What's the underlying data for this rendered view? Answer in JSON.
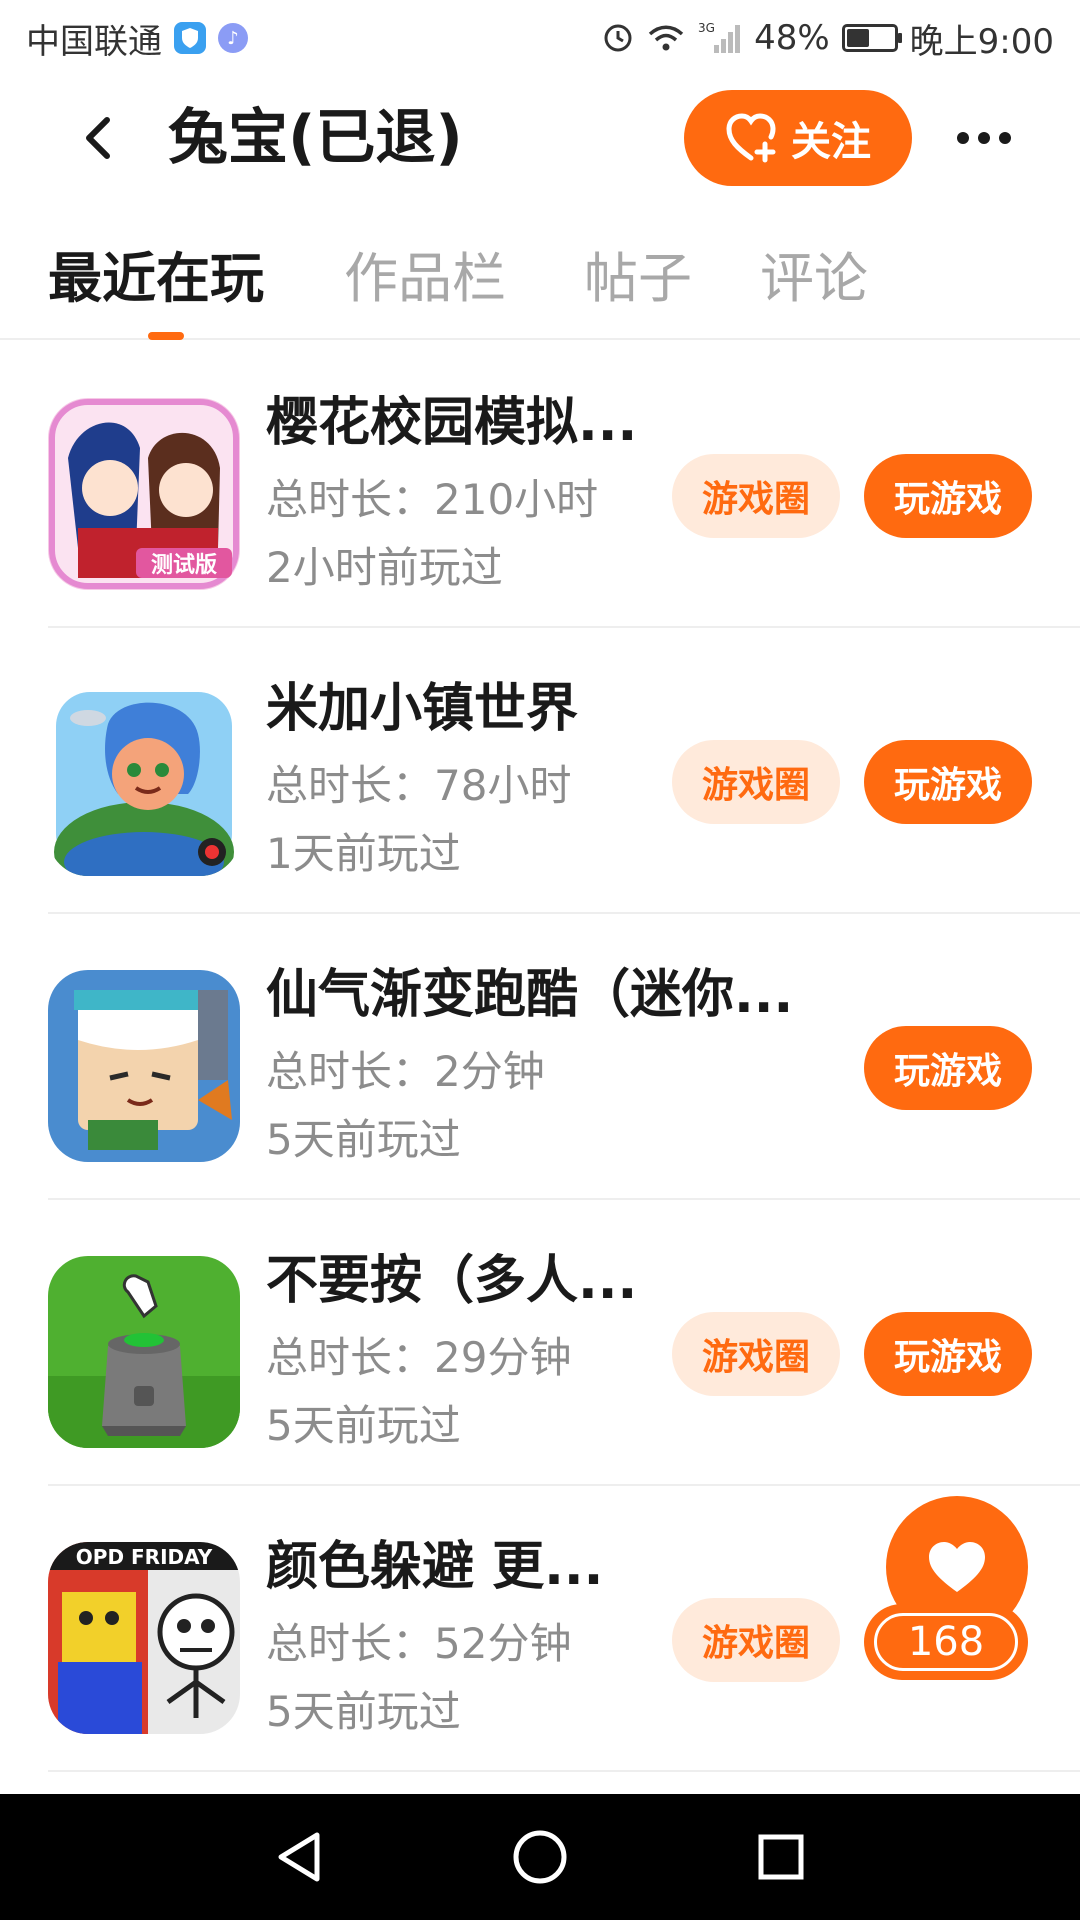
{
  "status_bar": {
    "carrier": "中国联通",
    "battery": "48%",
    "battery_level": 0.48,
    "time": "晚上9:00",
    "network": "3G",
    "icons": [
      "shield-icon",
      "music-icon",
      "alarm-icon",
      "wifi-icon",
      "signal-icon",
      "battery-icon"
    ]
  },
  "header": {
    "title": "兔宝(已退)",
    "follow_label": "关注",
    "icons": [
      "back-icon",
      "heart-plus-icon",
      "more-icon"
    ]
  },
  "tabs": [
    {
      "label": "最近在玩",
      "active": true
    },
    {
      "label": "作品栏",
      "active": false
    },
    {
      "label": "帖子",
      "active": false
    },
    {
      "label": "评论",
      "active": false
    }
  ],
  "games": [
    {
      "name": "樱花校园模拟...",
      "duration": "总时长：210小时",
      "last_played": "2小时前玩过",
      "icon_text": "测试版",
      "circle_label": "游戏圈",
      "play_label": "玩游戏"
    },
    {
      "name": "米加小镇世界",
      "duration": "总时长：78小时",
      "last_played": "1天前玩过",
      "circle_label": "游戏圈",
      "play_label": "玩游戏"
    },
    {
      "name": "仙气渐变跑酷（迷你...",
      "duration": "总时长：2分钟",
      "last_played": "5天前玩过",
      "play_label": "玩游戏"
    },
    {
      "name": "不要按（多人...",
      "duration": "总时长：29分钟",
      "last_played": "5天前玩过",
      "circle_label": "游戏圈",
      "play_label": "玩游戏"
    },
    {
      "name": "颜色躲避 更...",
      "duration": "总时长：52分钟",
      "last_played": "5天前玩过",
      "icon_text": "OPD FRIDAY",
      "circle_label": "游戏圈"
    }
  ],
  "like": {
    "count": "168",
    "icon": "heart-icon"
  },
  "nav": {
    "icons": [
      "back-triangle-icon",
      "home-circle-icon",
      "recents-square-icon"
    ]
  },
  "colors": {
    "accent": "#ff6a10",
    "accent_light": "#ffeadb",
    "muted_text": "#8c8c8c",
    "tab_inactive": "#a8a8a8"
  }
}
